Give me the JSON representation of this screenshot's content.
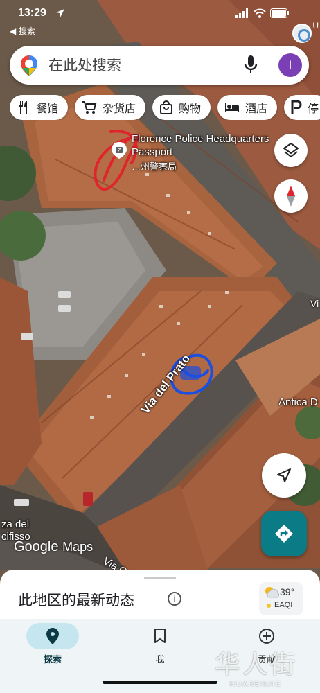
{
  "status_bar": {
    "time": "13:29",
    "back_app": "◀ 搜索",
    "edge_letter": "U"
  },
  "search": {
    "placeholder": "在此处搜索",
    "avatar_letter": "I"
  },
  "chips": [
    {
      "label": "餐馆",
      "icon": "restaurant-icon"
    },
    {
      "label": "杂货店",
      "icon": "cart-icon"
    },
    {
      "label": "购物",
      "icon": "shopping-bag-icon"
    },
    {
      "label": "酒店",
      "icon": "bed-icon"
    },
    {
      "label": "停",
      "icon": "parking-icon"
    }
  ],
  "map": {
    "poi_name": "Florence Police Headquarters Passport",
    "poi_sub": "…州警察局",
    "street_main": "Via del Prato",
    "street_lower": "Via G",
    "street_right": "Vi",
    "place_right": "Antica D",
    "place_left": "za del\ncifisso",
    "logo_google": "Google",
    "logo_maps": "Maps"
  },
  "sheet": {
    "title": "此地区的最新动态",
    "info": "i",
    "weather_temp": "39°",
    "weather_aqi": "EAQI"
  },
  "nav": [
    {
      "label": "探索",
      "icon": "explore-pin-icon",
      "active": true
    },
    {
      "label": "我",
      "icon": "bookmark-icon",
      "active": false
    },
    {
      "label": "贡献",
      "icon": "plus-circle-icon",
      "active": false
    }
  ],
  "watermark": {
    "cn": "华人街",
    "en": "HUARENJIE"
  },
  "colors": {
    "brand_teal": "#0b7b85",
    "avatar_purple": "#7b3fb5",
    "annotation_red": "#e0242b",
    "annotation_blue": "#1a4fe0"
  }
}
